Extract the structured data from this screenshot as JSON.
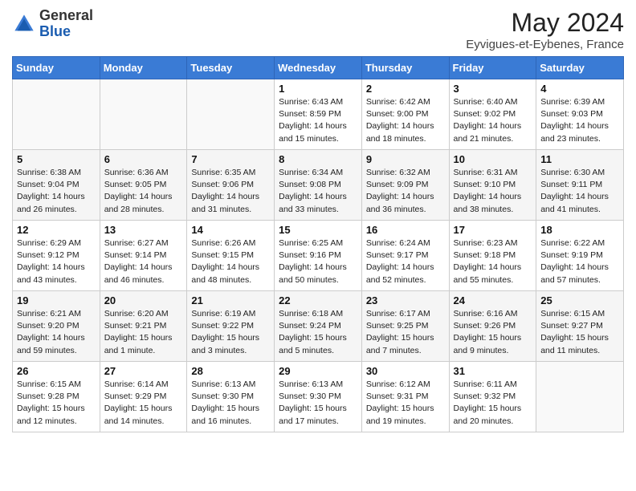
{
  "header": {
    "logo_general": "General",
    "logo_blue": "Blue",
    "month_year": "May 2024",
    "location": "Eyvigues-et-Eybenes, France"
  },
  "days_of_week": [
    "Sunday",
    "Monday",
    "Tuesday",
    "Wednesday",
    "Thursday",
    "Friday",
    "Saturday"
  ],
  "weeks": [
    [
      {
        "day": "",
        "text": ""
      },
      {
        "day": "",
        "text": ""
      },
      {
        "day": "",
        "text": ""
      },
      {
        "day": "1",
        "text": "Sunrise: 6:43 AM\nSunset: 8:59 PM\nDaylight: 14 hours\nand 15 minutes."
      },
      {
        "day": "2",
        "text": "Sunrise: 6:42 AM\nSunset: 9:00 PM\nDaylight: 14 hours\nand 18 minutes."
      },
      {
        "day": "3",
        "text": "Sunrise: 6:40 AM\nSunset: 9:02 PM\nDaylight: 14 hours\nand 21 minutes."
      },
      {
        "day": "4",
        "text": "Sunrise: 6:39 AM\nSunset: 9:03 PM\nDaylight: 14 hours\nand 23 minutes."
      }
    ],
    [
      {
        "day": "5",
        "text": "Sunrise: 6:38 AM\nSunset: 9:04 PM\nDaylight: 14 hours\nand 26 minutes."
      },
      {
        "day": "6",
        "text": "Sunrise: 6:36 AM\nSunset: 9:05 PM\nDaylight: 14 hours\nand 28 minutes."
      },
      {
        "day": "7",
        "text": "Sunrise: 6:35 AM\nSunset: 9:06 PM\nDaylight: 14 hours\nand 31 minutes."
      },
      {
        "day": "8",
        "text": "Sunrise: 6:34 AM\nSunset: 9:08 PM\nDaylight: 14 hours\nand 33 minutes."
      },
      {
        "day": "9",
        "text": "Sunrise: 6:32 AM\nSunset: 9:09 PM\nDaylight: 14 hours\nand 36 minutes."
      },
      {
        "day": "10",
        "text": "Sunrise: 6:31 AM\nSunset: 9:10 PM\nDaylight: 14 hours\nand 38 minutes."
      },
      {
        "day": "11",
        "text": "Sunrise: 6:30 AM\nSunset: 9:11 PM\nDaylight: 14 hours\nand 41 minutes."
      }
    ],
    [
      {
        "day": "12",
        "text": "Sunrise: 6:29 AM\nSunset: 9:12 PM\nDaylight: 14 hours\nand 43 minutes."
      },
      {
        "day": "13",
        "text": "Sunrise: 6:27 AM\nSunset: 9:14 PM\nDaylight: 14 hours\nand 46 minutes."
      },
      {
        "day": "14",
        "text": "Sunrise: 6:26 AM\nSunset: 9:15 PM\nDaylight: 14 hours\nand 48 minutes."
      },
      {
        "day": "15",
        "text": "Sunrise: 6:25 AM\nSunset: 9:16 PM\nDaylight: 14 hours\nand 50 minutes."
      },
      {
        "day": "16",
        "text": "Sunrise: 6:24 AM\nSunset: 9:17 PM\nDaylight: 14 hours\nand 52 minutes."
      },
      {
        "day": "17",
        "text": "Sunrise: 6:23 AM\nSunset: 9:18 PM\nDaylight: 14 hours\nand 55 minutes."
      },
      {
        "day": "18",
        "text": "Sunrise: 6:22 AM\nSunset: 9:19 PM\nDaylight: 14 hours\nand 57 minutes."
      }
    ],
    [
      {
        "day": "19",
        "text": "Sunrise: 6:21 AM\nSunset: 9:20 PM\nDaylight: 14 hours\nand 59 minutes."
      },
      {
        "day": "20",
        "text": "Sunrise: 6:20 AM\nSunset: 9:21 PM\nDaylight: 15 hours\nand 1 minute."
      },
      {
        "day": "21",
        "text": "Sunrise: 6:19 AM\nSunset: 9:22 PM\nDaylight: 15 hours\nand 3 minutes."
      },
      {
        "day": "22",
        "text": "Sunrise: 6:18 AM\nSunset: 9:24 PM\nDaylight: 15 hours\nand 5 minutes."
      },
      {
        "day": "23",
        "text": "Sunrise: 6:17 AM\nSunset: 9:25 PM\nDaylight: 15 hours\nand 7 minutes."
      },
      {
        "day": "24",
        "text": "Sunrise: 6:16 AM\nSunset: 9:26 PM\nDaylight: 15 hours\nand 9 minutes."
      },
      {
        "day": "25",
        "text": "Sunrise: 6:15 AM\nSunset: 9:27 PM\nDaylight: 15 hours\nand 11 minutes."
      }
    ],
    [
      {
        "day": "26",
        "text": "Sunrise: 6:15 AM\nSunset: 9:28 PM\nDaylight: 15 hours\nand 12 minutes."
      },
      {
        "day": "27",
        "text": "Sunrise: 6:14 AM\nSunset: 9:29 PM\nDaylight: 15 hours\nand 14 minutes."
      },
      {
        "day": "28",
        "text": "Sunrise: 6:13 AM\nSunset: 9:30 PM\nDaylight: 15 hours\nand 16 minutes."
      },
      {
        "day": "29",
        "text": "Sunrise: 6:13 AM\nSunset: 9:30 PM\nDaylight: 15 hours\nand 17 minutes."
      },
      {
        "day": "30",
        "text": "Sunrise: 6:12 AM\nSunset: 9:31 PM\nDaylight: 15 hours\nand 19 minutes."
      },
      {
        "day": "31",
        "text": "Sunrise: 6:11 AM\nSunset: 9:32 PM\nDaylight: 15 hours\nand 20 minutes."
      },
      {
        "day": "",
        "text": ""
      }
    ]
  ]
}
